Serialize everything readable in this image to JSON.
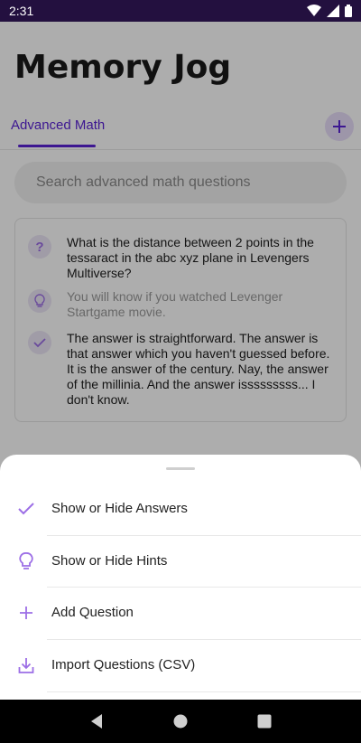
{
  "status_bar": {
    "time": "2:31"
  },
  "app": {
    "title": "Memory Jog",
    "tabs": [
      {
        "label": "Advanced Math"
      }
    ],
    "search": {
      "placeholder": "Search advanced math questions"
    },
    "card": {
      "question": "What is the distance between 2 points in the tessaract in the abc xyz plane in Levengers Multiverse?",
      "hint": "You will know if you watched Levenger Startgame movie.",
      "answer": "The answer is straightforward. The answer is that answer which you haven't guessed before. It is the answer of the century. Nay, the answer of the millinia. And the answer isssssssss... I don't know."
    }
  },
  "bottom_sheet": {
    "items": [
      {
        "label": "Show or Hide Answers",
        "icon": "check-icon"
      },
      {
        "label": "Show or Hide Hints",
        "icon": "lightbulb-icon"
      },
      {
        "label": "Add Question",
        "icon": "plus-icon"
      },
      {
        "label": "Import Questions (CSV)",
        "icon": "download-icon"
      }
    ]
  },
  "colors": {
    "accent": "#5a22d6",
    "status_bar": "#23103f",
    "icon_purple": "#9c6ee6"
  }
}
